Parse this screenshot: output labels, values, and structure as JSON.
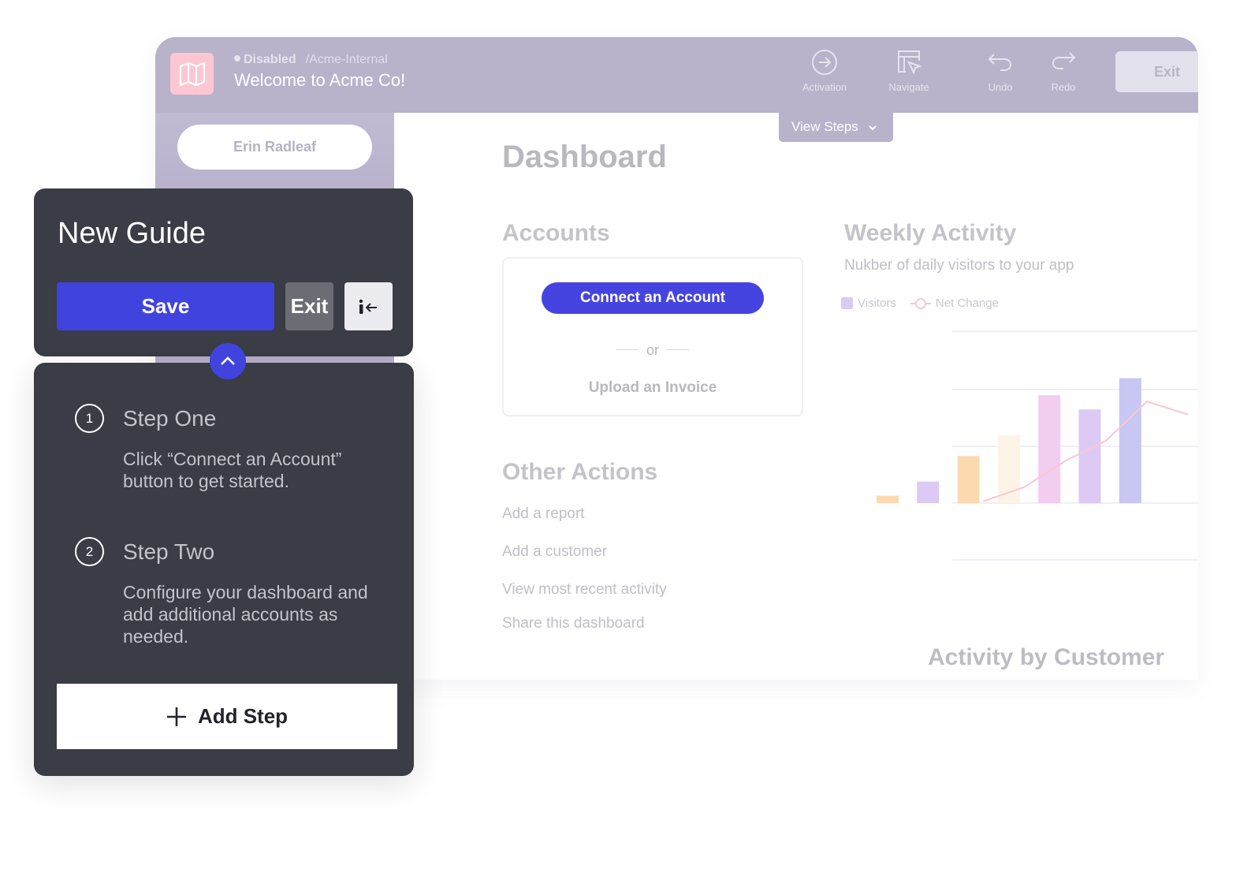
{
  "header": {
    "status": "Disabled",
    "path": "/Acme-Internal",
    "title": "Welcome to Acme Co!",
    "tools": [
      {
        "label": "Activation",
        "icon": "arrow-circle-icon"
      },
      {
        "label": "Navigate",
        "icon": "navigate-icon"
      },
      {
        "label": "Undo",
        "icon": "undo-icon"
      },
      {
        "label": "Redo",
        "icon": "redo-icon"
      }
    ],
    "exit_label": "Exit",
    "view_steps_label": "View Steps"
  },
  "sidebar": {
    "user": "Erin Radleaf"
  },
  "main": {
    "title": "Dashboard",
    "accounts": {
      "title": "Accounts",
      "connect_label": "Connect an Account",
      "or": "or",
      "upload_label": "Upload an Invoice"
    },
    "other_actions": {
      "title": "Other Actions",
      "items": [
        "Add a report",
        "Add a customer",
        "View most recent activity",
        "Share this dashboard"
      ]
    },
    "weekly": {
      "title": "Weekly Activity",
      "subtitle": "Nukber of daily visitors to your app"
    },
    "activity_by_customer": "Activity by Customer"
  },
  "chart_data": {
    "type": "bar",
    "title": "Weekly Activity",
    "legend": [
      "Visitors",
      "Net Change"
    ],
    "legend_placement": "top-left",
    "grid": true,
    "ylim": [
      0,
      3
    ],
    "series": [
      {
        "name": "Visitors",
        "type": "bar",
        "values": [
          0.13,
          0.38,
          0.83,
          1.2,
          1.9,
          1.65,
          2.2
        ],
        "colors": [
          "#fdd9b0",
          "#dccaf5",
          "#fdd9b0",
          "#fdf3e7",
          "#f2cdef",
          "#dccaf5",
          "#c8c6f2"
        ]
      },
      {
        "name": "Net Change",
        "type": "line",
        "values": [
          0.03,
          0.28,
          0.74,
          1.1,
          1.79,
          1.56,
          2.0
        ],
        "color": "#fbc6d2"
      }
    ]
  },
  "guide": {
    "title": "New Guide",
    "save_label": "Save",
    "exit_label": "Exit",
    "steps": [
      {
        "num": "1",
        "title": "Step One",
        "desc": "Click “Connect an Account” button to get started."
      },
      {
        "num": "2",
        "title": "Step Two",
        "desc": "Configure your dashboard and add additional accounts as needed."
      }
    ],
    "add_step_label": "Add Step"
  },
  "colors": {
    "accent": "#4143de",
    "header": "#b8b3cb",
    "panel": "#3a3c46",
    "logo": "#fcc6d3"
  }
}
